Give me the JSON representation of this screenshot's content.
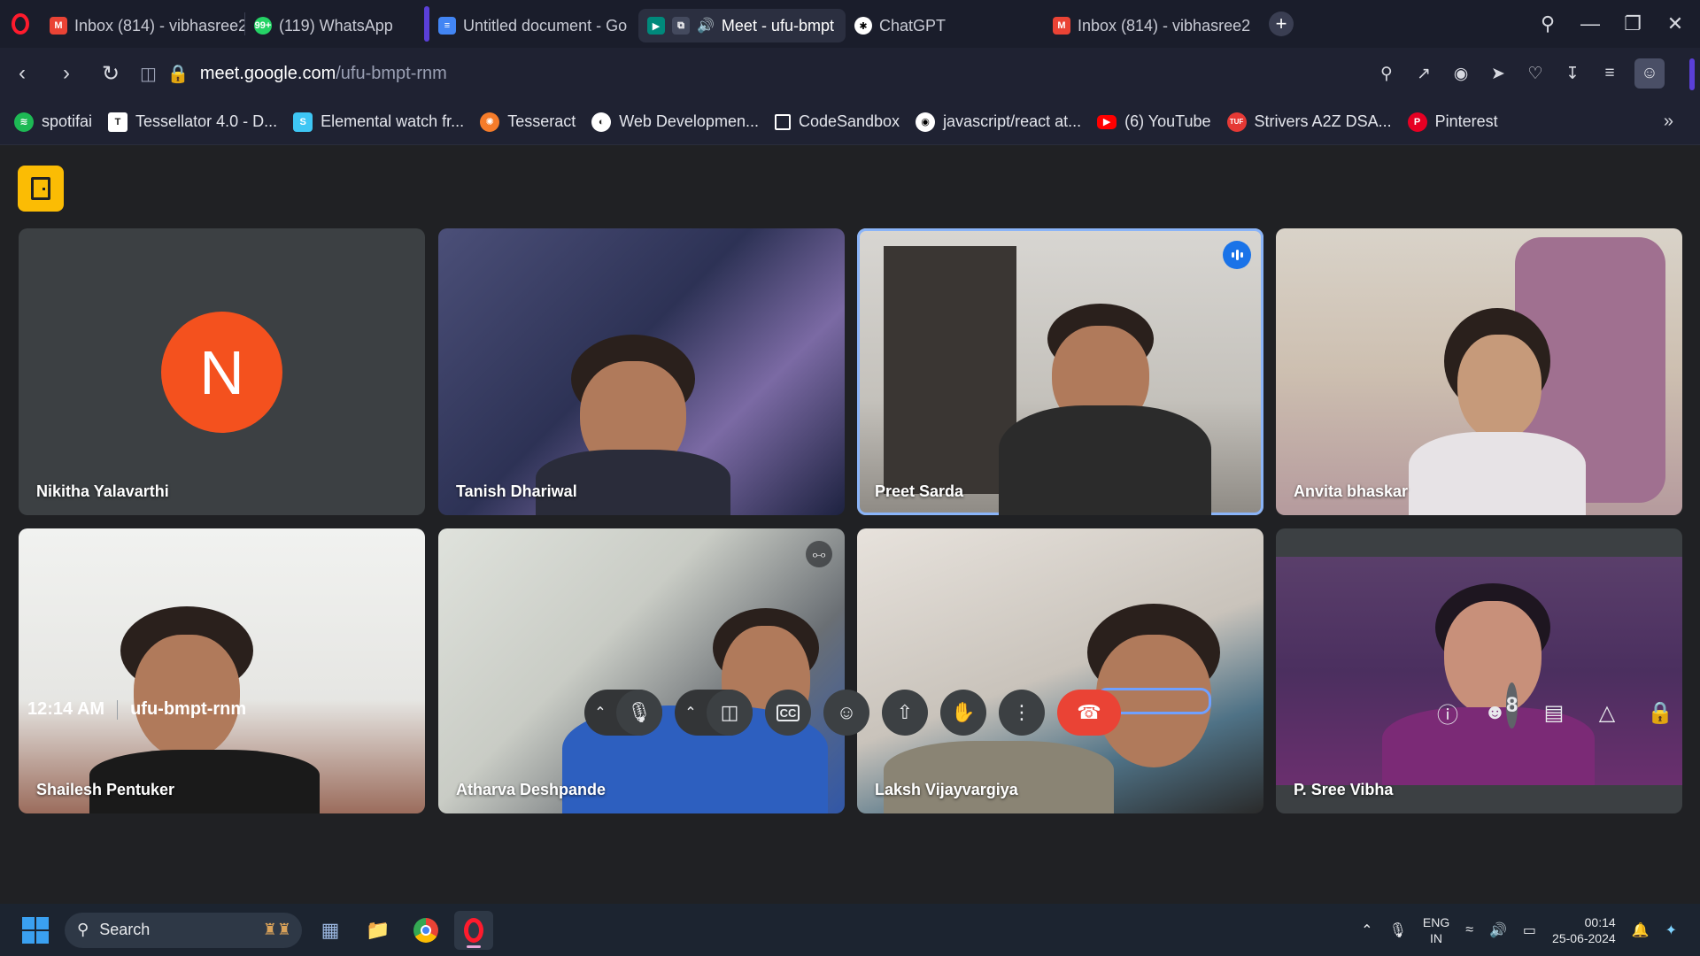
{
  "browser": {
    "tabs": [
      {
        "title": "Inbox (814) - vibhasree2",
        "icon": "gmail-icon",
        "color": "#ea4335",
        "active": false
      },
      {
        "title": "(119) WhatsApp",
        "icon": "whatsapp-icon",
        "color": "#25d366",
        "badge": "99+",
        "active": false
      },
      {
        "title": "Untitled document - Go",
        "icon": "google-docs-icon",
        "color": "#4285f4",
        "active": false
      },
      {
        "title": "Meet - ufu-bmpt",
        "icon": "google-meet-icon",
        "color": "#00897b",
        "active": true
      },
      {
        "title": "ChatGPT",
        "icon": "chatgpt-icon",
        "color": "#ffffff",
        "active": false
      },
      {
        "title": "Inbox (814) - vibhasree2",
        "icon": "gmail-icon",
        "color": "#ea4335",
        "active": false
      }
    ],
    "url": {
      "host": "meet.google.com",
      "path": "/ufu-bmpt-rnm"
    },
    "bookmarks": [
      {
        "label": "spotifai",
        "icon": "spotify-icon",
        "color": "#1db954"
      },
      {
        "label": "Tessellator 4.0 - D...",
        "icon": "tessellator-icon",
        "color": "#ffffff"
      },
      {
        "label": "Elemental watch fr...",
        "icon": "elemental-icon",
        "color": "#3ec6f4"
      },
      {
        "label": "Tesseract",
        "icon": "tesseract-icon",
        "color": "#f57c2a"
      },
      {
        "label": "Web Developmen...",
        "icon": "webdev-icon",
        "color": "#ffffff"
      },
      {
        "label": "CodeSandbox",
        "icon": "codesandbox-icon",
        "color": "#ffffff"
      },
      {
        "label": "javascript/react at...",
        "icon": "github-icon",
        "color": "#ffffff"
      },
      {
        "label": "(6) YouTube",
        "icon": "youtube-icon",
        "color": "#ff0000"
      },
      {
        "label": "Strivers A2Z DSA...",
        "icon": "tuf-icon",
        "color": "#e53935"
      },
      {
        "label": "Pinterest",
        "icon": "pinterest-icon",
        "color": "#e60023"
      }
    ]
  },
  "meet": {
    "participants": [
      {
        "name": "Nikitha Yalavarthi",
        "initial": "N"
      },
      {
        "name": "Tanish Dhariwal"
      },
      {
        "name": "Preet Sarda",
        "speaking": true
      },
      {
        "name": "Anvita bhaskar"
      },
      {
        "name": "Shailesh Pentuker"
      },
      {
        "name": "Atharva Deshpande",
        "muted": true
      },
      {
        "name": "Laksh Vijayvargiya"
      },
      {
        "name": "P. Sree Vibha"
      }
    ],
    "time": "12:14 AM",
    "meeting_code": "ufu-bmpt-rnm",
    "participant_count": "8",
    "colors": {
      "accent": "#8ab4f8",
      "end_call": "#ea4335",
      "room_badge": "#fbbc04",
      "avatar": "#f4511e"
    }
  },
  "taskbar": {
    "search_label": "Search",
    "lang_top": "ENG",
    "lang_bottom": "IN",
    "clock_time": "00:14",
    "clock_date": "25-06-2024"
  }
}
